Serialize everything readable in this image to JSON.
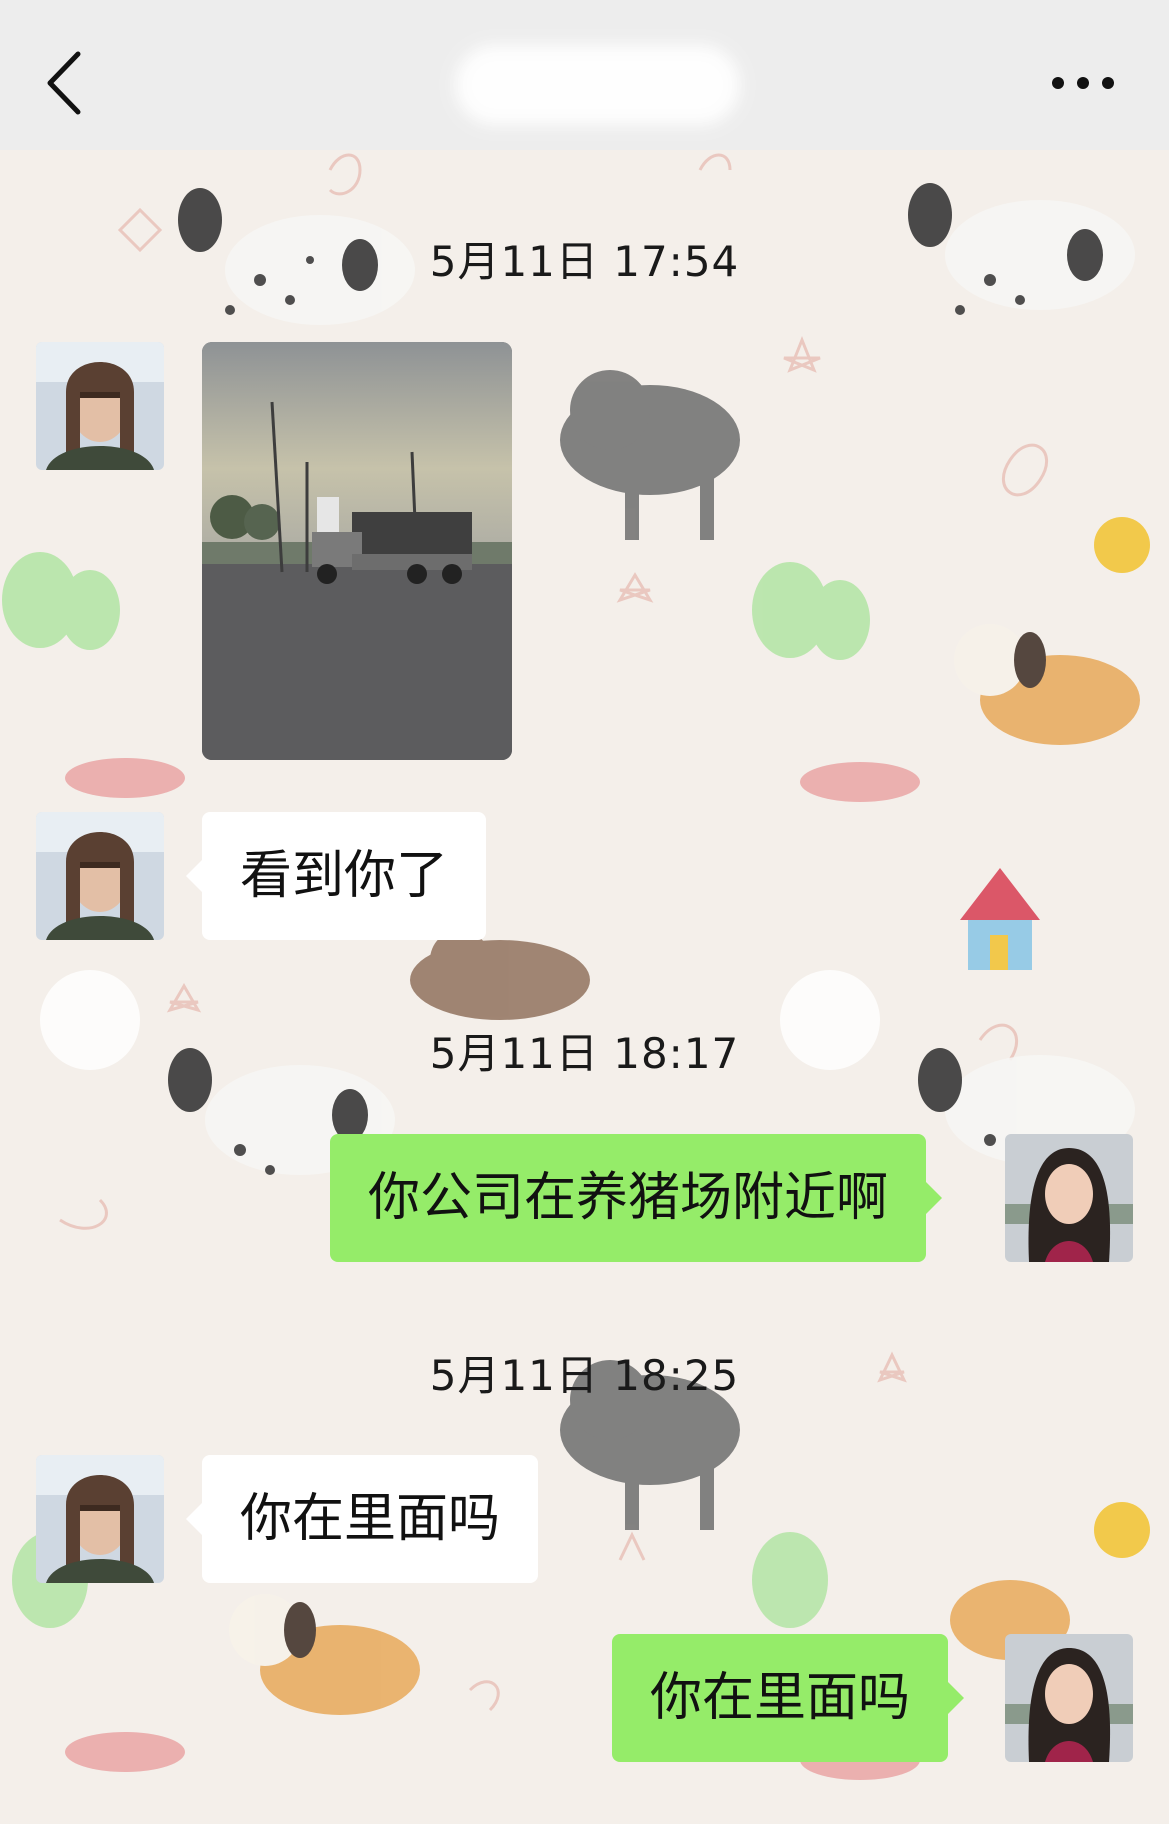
{
  "header": {
    "title": "",
    "back_icon": "chevron-left-icon",
    "more_icon": "more-dots-icon"
  },
  "messages": [
    {
      "type": "timestamp",
      "text": "5月11日 17:54"
    },
    {
      "type": "image",
      "side": "left",
      "description_icon": "photo-thumbnail"
    },
    {
      "type": "text",
      "side": "left",
      "text": "看到你了"
    },
    {
      "type": "timestamp",
      "text": "5月11日 18:17"
    },
    {
      "type": "text",
      "side": "right",
      "text": "你公司在养猪场附近啊"
    },
    {
      "type": "timestamp",
      "text": "5月11日 18:25"
    },
    {
      "type": "text",
      "side": "left",
      "text": "你在里面吗"
    },
    {
      "type": "text",
      "side": "right",
      "text": "你在里面吗"
    }
  ],
  "colors": {
    "outgoing_bubble": "#95ec69",
    "incoming_bubble": "#ffffff",
    "topbar": "#ededed",
    "background": "#f4efea"
  }
}
